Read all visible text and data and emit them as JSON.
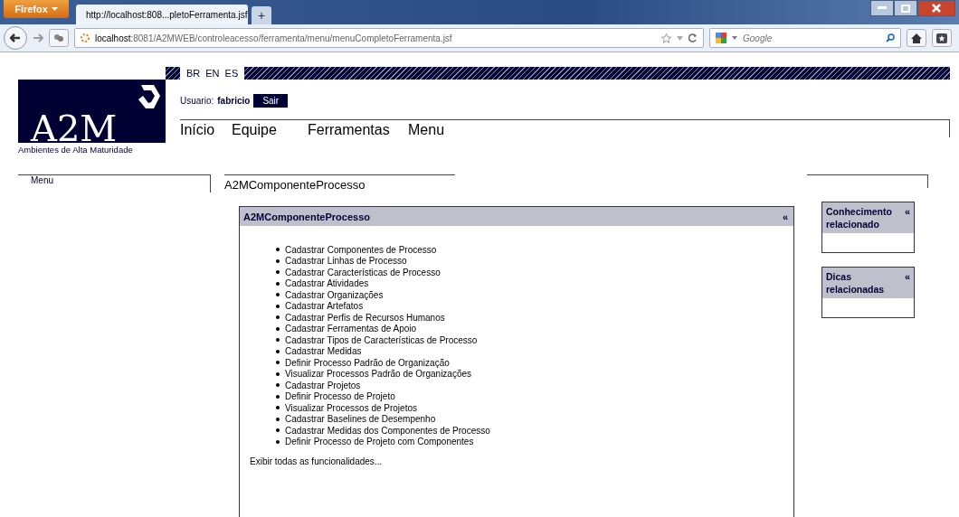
{
  "browser": {
    "menu_button": "Firefox",
    "tabs": [
      {
        "label": "http://localhost:808...pletoFerramenta.jsf",
        "selected": true
      }
    ],
    "new_tab": "+",
    "url_host": "localhost",
    "url_path": ":8081/A2MWEB/controleacesso/ferramenta/menu/menuCompletoFerramenta.jsf",
    "search_placeholder": "Google"
  },
  "languages": [
    "BR",
    "EN",
    "ES"
  ],
  "logo": {
    "text": "A2M",
    "subtitle": "Ambientes de Alta Maturidade"
  },
  "user": {
    "label": "Usuario:",
    "name": "fabricio",
    "logout": "Sair"
  },
  "nav": [
    "Início",
    "Equipe",
    "Ferramentas",
    "Menu"
  ],
  "left_panel": {
    "title": "Menu"
  },
  "page_title": "A2MComponenteProcesso",
  "main_panel": {
    "title": "A2MComponenteProcesso",
    "collapse": "«",
    "items": [
      "Cadastrar Componentes de Processo",
      "Cadastrar Linhas de Processo",
      "Cadastrar Características de Processo",
      "Cadastrar Atividades",
      "Cadastrar Organizações",
      "Cadastrar Artefatos",
      "Cadastrar Perfis de Recursos Humanos",
      "Cadastrar Ferramentas de Apoio",
      "Cadastrar Tipos de Características de Processo",
      "Cadastrar Medidas",
      "Definir Processo Padrão de Organização",
      "Visualizar Processos Padrão de Organizações",
      "Cadastrar Projetos",
      "Definir Processo de Projeto",
      "Visualizar Processos de Projetos",
      "Cadastrar Baselines de Desempenho",
      "Cadastrar Medidas dos Componentes de Processo",
      "Definir Processo de Projeto com Componentes"
    ],
    "show_all": "Exibir todas as funcionalidades..."
  },
  "side_boxes": [
    {
      "title": "Conhecimento relacionado",
      "collapse": "«"
    },
    {
      "title": "Dicas relacionadas",
      "collapse": "«"
    }
  ]
}
